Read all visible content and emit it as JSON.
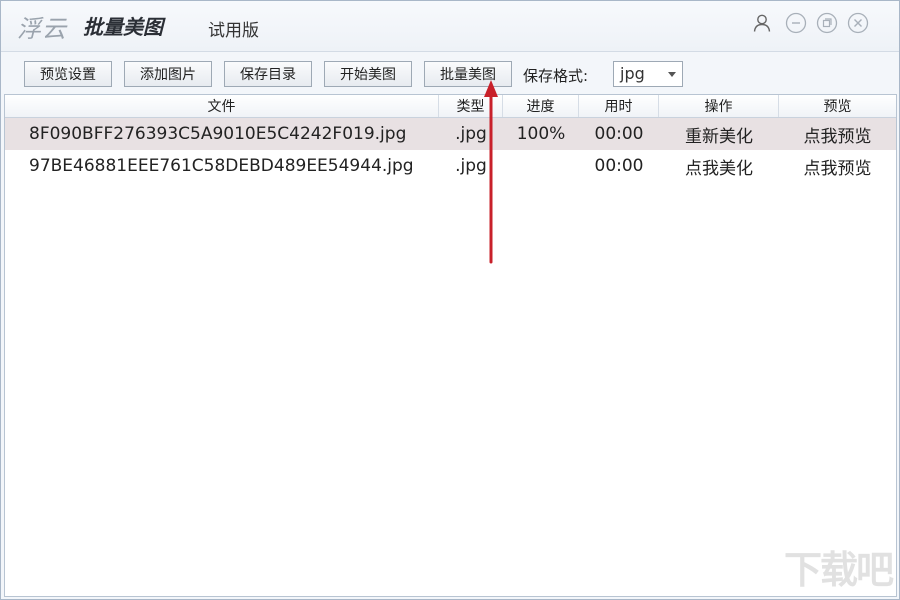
{
  "window": {
    "logo_text": "浮云",
    "app_name": "批量美图",
    "edition": "试用版"
  },
  "toolbar": {
    "buttons": [
      "预览设置",
      "添加图片",
      "保存目录",
      "开始美图",
      "批量美图"
    ],
    "format_label": "保存格式:",
    "format_value": "jpg"
  },
  "table": {
    "columns": [
      "文件",
      "类型",
      "进度",
      "用时",
      "操作",
      "预览"
    ],
    "rows": [
      {
        "file": "8F090BFF276393C5A9010E5C4242F019.jpg",
        "type": ".jpg",
        "progress": "100%",
        "time": "00:00",
        "action": "重新美化",
        "preview": "点我预览"
      },
      {
        "file": "97BE46881EEE761C58DEBD489EE54944.jpg",
        "type": ".jpg",
        "progress": "",
        "time": "00:00",
        "action": "点我美化",
        "preview": "点我预览"
      }
    ]
  },
  "colors": {
    "annotation_arrow": "#c8202a",
    "selected_row": "#e8e1e3"
  },
  "icons": [
    "user-icon",
    "minimize-icon",
    "restore-icon",
    "close-icon"
  ]
}
